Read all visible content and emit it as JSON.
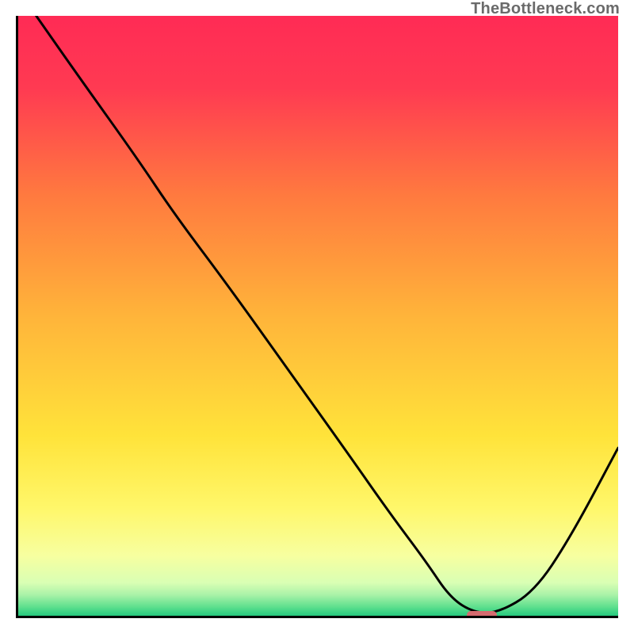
{
  "watermark": "TheBottleneck.com",
  "chart_data": {
    "type": "line",
    "title": "",
    "xlabel": "",
    "ylabel": "",
    "xlim": [
      0,
      100
    ],
    "ylim": [
      0,
      100
    ],
    "grid": false,
    "series": [
      {
        "name": "bottleneck-curve",
        "x": [
          3,
          10,
          20,
          26,
          35,
          45,
          55,
          62,
          68,
          72,
          76,
          80,
          86,
          92,
          100
        ],
        "values": [
          100,
          90,
          76,
          67,
          55,
          41,
          27,
          17,
          9,
          3,
          0.5,
          0.5,
          4,
          13,
          28
        ]
      }
    ],
    "marker": {
      "name": "target-indicator",
      "x_start": 74.5,
      "x_end": 79.5,
      "y": 0.5,
      "color": "#d56b6f"
    },
    "gradient_stops": [
      {
        "offset": 0.0,
        "color": "#ff2b55"
      },
      {
        "offset": 0.12,
        "color": "#ff3a52"
      },
      {
        "offset": 0.3,
        "color": "#ff7a3f"
      },
      {
        "offset": 0.5,
        "color": "#ffb43a"
      },
      {
        "offset": 0.7,
        "color": "#ffe33a"
      },
      {
        "offset": 0.82,
        "color": "#fff76a"
      },
      {
        "offset": 0.9,
        "color": "#f7ffa0"
      },
      {
        "offset": 0.945,
        "color": "#d9ffb4"
      },
      {
        "offset": 0.965,
        "color": "#aaf2a8"
      },
      {
        "offset": 0.985,
        "color": "#5fe08e"
      },
      {
        "offset": 1.0,
        "color": "#25c97e"
      }
    ]
  }
}
